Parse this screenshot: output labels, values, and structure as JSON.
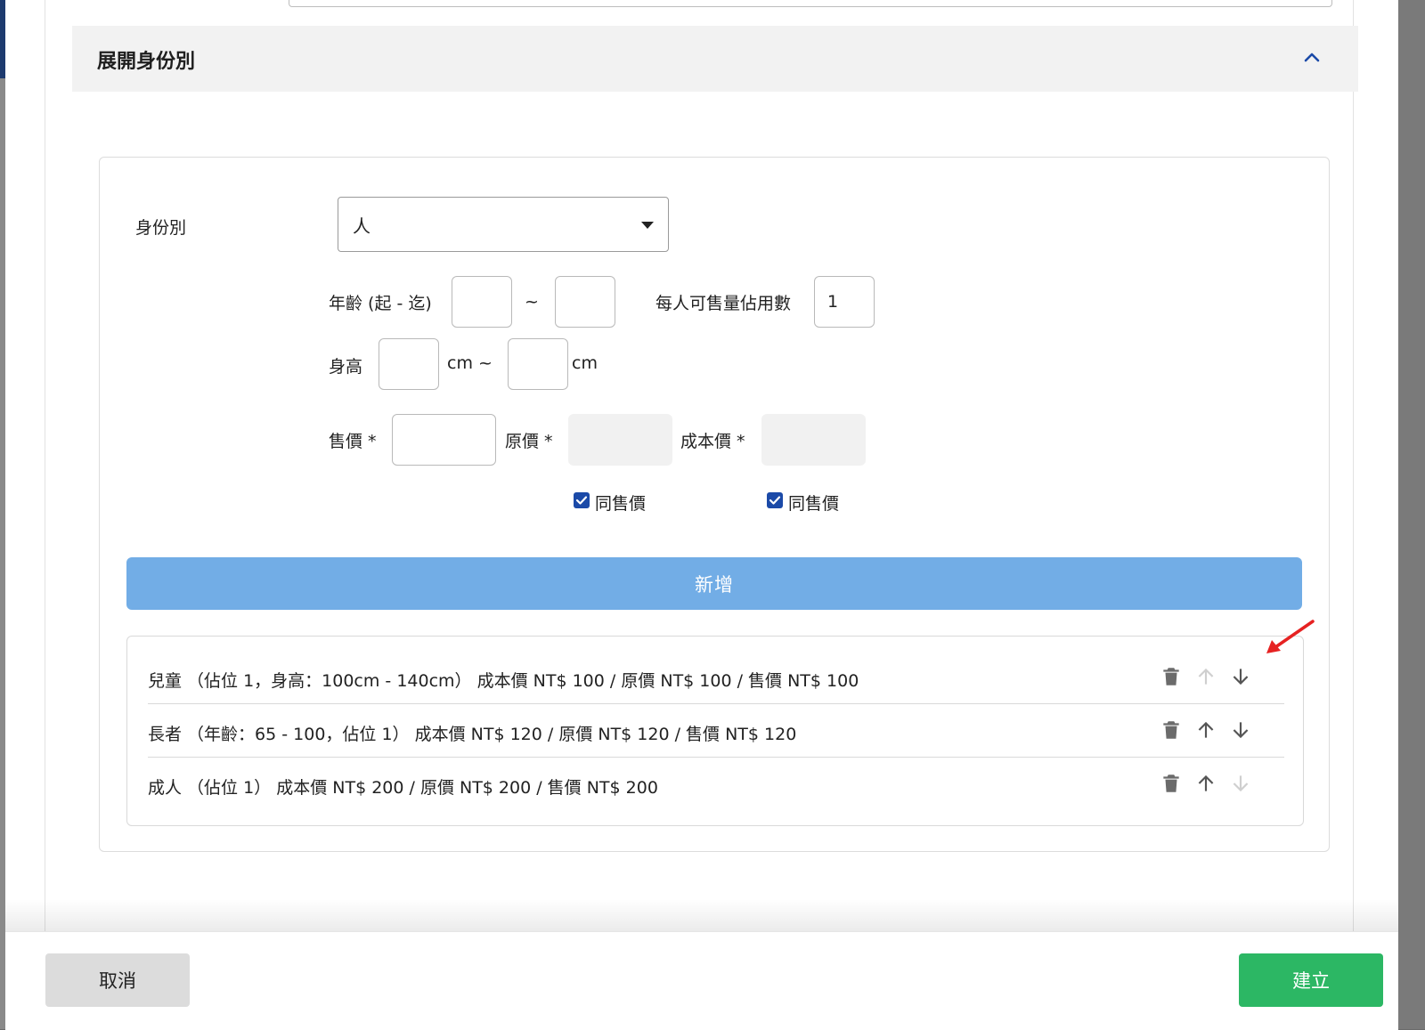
{
  "section": {
    "title": "展開身份別"
  },
  "form": {
    "identity_label": "身份別",
    "identity_value": "人",
    "age_label": "年齡 (起 - 迄)",
    "age_from": "",
    "age_to": "",
    "tilde": "~",
    "occupancy_label": "每人可售量佔用數",
    "occupancy_value": "1",
    "height_label": "身高",
    "height_from": "",
    "height_unit_mid": "cm ~",
    "height_to": "",
    "height_unit_end": "cm",
    "sale_price_label": "售價 *",
    "sale_price_value": "",
    "original_price_label": "原價 *",
    "original_price_value": "",
    "cost_price_label": "成本價 *",
    "cost_price_value": "",
    "same_as_sale_1": "同售價",
    "same_as_sale_1_checked": true,
    "same_as_sale_2": "同售價",
    "same_as_sale_2_checked": true,
    "add_button": "新增"
  },
  "items": [
    {
      "text": "兒童 （佔位 1，身高：100cm - 140cm） 成本價 NT$ 100 / 原價 NT$ 100 / 售價 NT$ 100"
    },
    {
      "text": "長者 （年齡：65 - 100，佔位 1） 成本價 NT$ 120 / 原價 NT$ 120 / 售價 NT$ 120"
    },
    {
      "text": "成人 （佔位 1） 成本價 NT$ 200 / 原價 NT$ 200 / 售價 NT$ 200"
    }
  ],
  "icons": {
    "delete": "trash-icon",
    "up": "arrow-up-icon",
    "down": "arrow-down-icon",
    "collapse": "chevron-up-icon",
    "annotation": "red-arrow-annotation"
  },
  "colors": {
    "primary_blue": "#72ade6",
    "checkbox_blue": "#1b4aa8",
    "create_green": "#2cb764",
    "annotation_red": "#e62222"
  },
  "footer": {
    "cancel": "取消",
    "create": "建立"
  }
}
